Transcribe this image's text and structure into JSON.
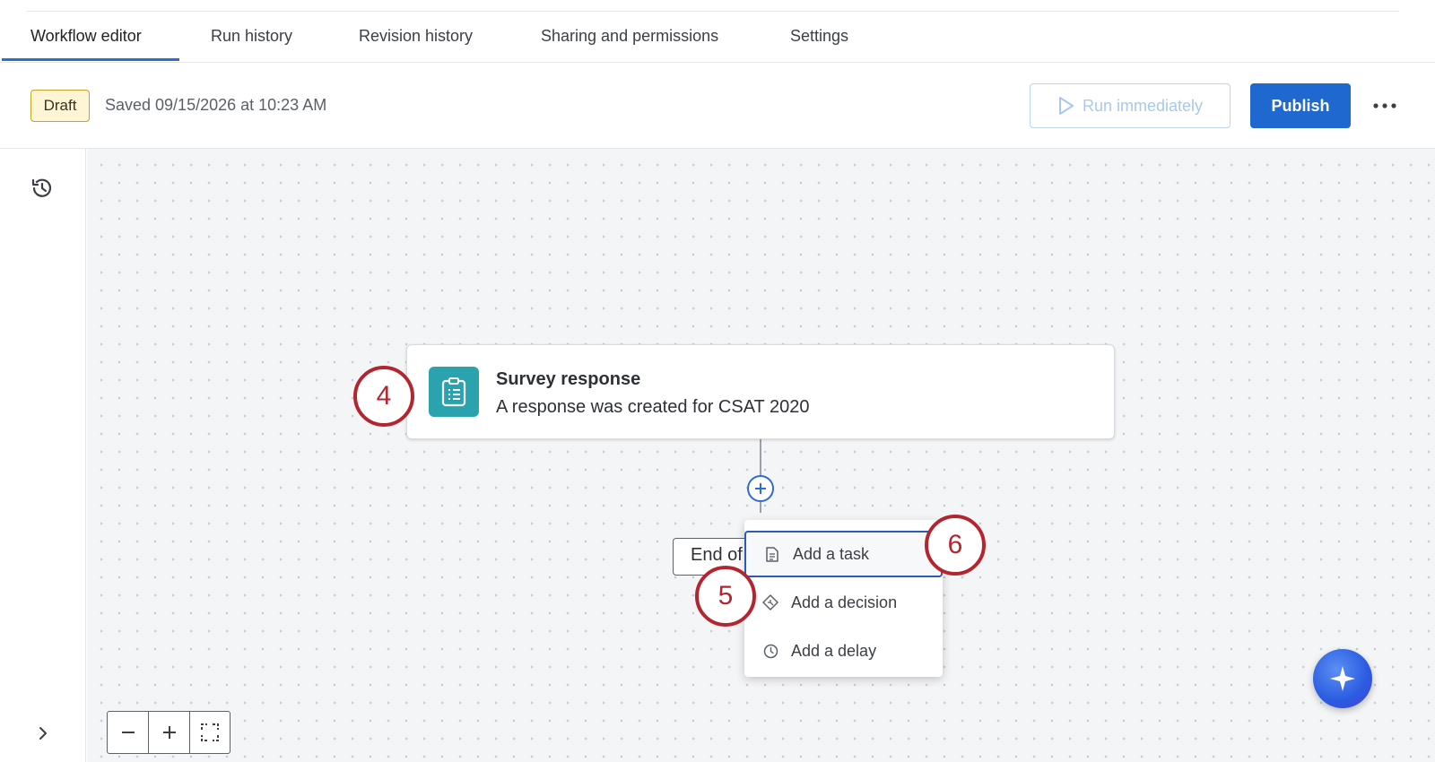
{
  "tabs": [
    {
      "label": "Workflow editor",
      "active": true
    },
    {
      "label": "Run history"
    },
    {
      "label": "Revision history"
    },
    {
      "label": "Sharing and permissions"
    },
    {
      "label": "Settings"
    }
  ],
  "toolbar": {
    "status_badge": "Draft",
    "saved_text": "Saved 09/15/2026 at 10:23 AM",
    "run_label": "Run immediately",
    "publish_label": "Publish",
    "more_icon": "more-horizontal-icon"
  },
  "trigger": {
    "title": "Survey response",
    "description": "A response was created for CSAT 2020",
    "icon": "clipboard-icon"
  },
  "end_label": "End of",
  "add_menu": {
    "items": [
      {
        "label": "Add a task",
        "icon": "task-icon"
      },
      {
        "label": "Add a decision",
        "icon": "decision-icon"
      },
      {
        "label": "Add a delay",
        "icon": "clock-icon"
      }
    ]
  },
  "callouts": [
    "4",
    "5",
    "6"
  ],
  "colors": {
    "primary": "#1f68d0",
    "callout": "#b3262f",
    "trigger_icon_bg": "#2aa3ae",
    "draft_bg": "#fdf5d3"
  }
}
